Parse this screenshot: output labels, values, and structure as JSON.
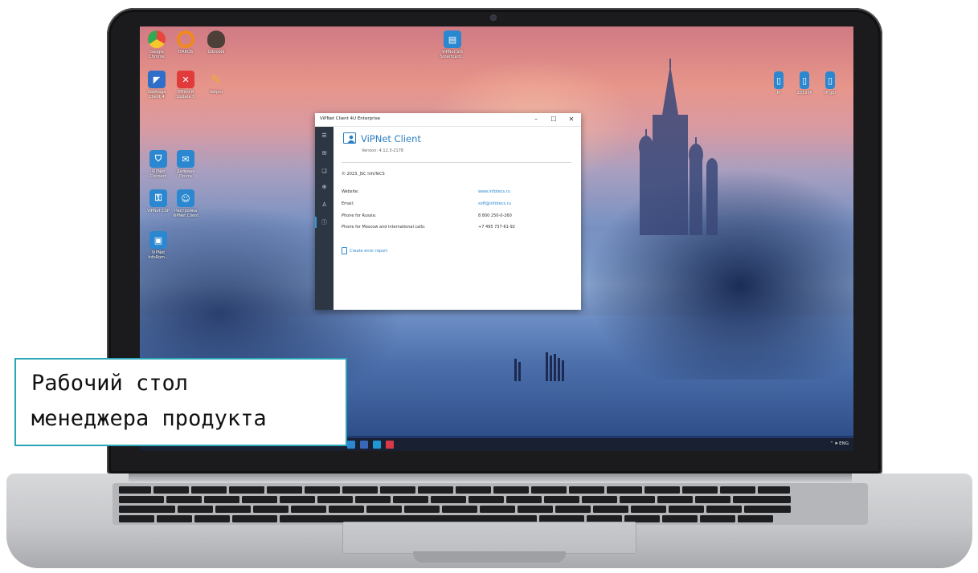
{
  "desktop": {
    "icons": [
      {
        "label": "Google Chrome",
        "icon": "chrome-icon",
        "color": "#e8453c"
      },
      {
        "label": "ITAROS",
        "icon": "itaros-icon",
        "color": "#f08a1c"
      },
      {
        "label": "Gibrovid",
        "icon": "gibrovid-icon",
        "color": "#5a4a3a"
      },
      {
        "label": "Sabfraga Client 4",
        "icon": "sabfraga-icon",
        "color": "#2f6fc9"
      },
      {
        "label": "XMind 8 Update 5",
        "icon": "xmind-icon",
        "color": "#e23b3b"
      },
      {
        "label": "Xetpro",
        "icon": "xetpro-icon",
        "color": "#d59a2a"
      },
      {
        "label": "ViPNet Connect",
        "icon": "vipnet-connect-icon",
        "color": "#2a87d0"
      },
      {
        "label": "Деловая Почта",
        "icon": "business-mail-icon",
        "color": "#2a87d0"
      },
      {
        "label": "ViPNet CSP",
        "icon": "vipnet-csp-icon",
        "color": "#2a87d0"
      },
      {
        "label": "Настройка ViPNet Client",
        "icon": "vipnet-settings-icon",
        "color": "#2a87d0"
      },
      {
        "label": "ViPNet InfoRom...",
        "icon": "vipnet-inforom-icon",
        "color": "#2a87d0"
      },
      {
        "label": "ViPNet SIS Smartcard...",
        "icon": "vipnet-sis-icon",
        "color": "#2a87d0"
      },
      {
        "label": "IP",
        "icon": "file-icon",
        "color": "#2a87d0"
      },
      {
        "label": "2019 IP",
        "icon": "file-icon",
        "color": "#2a87d0"
      },
      {
        "label": "IP gbl",
        "icon": "file-icon",
        "color": "#2a87d0"
      }
    ]
  },
  "window": {
    "title": "ViPNet Client 4U Enterprise",
    "minimize": "–",
    "maximize": "☐",
    "close": "✕",
    "app_name": "ViPNet Client",
    "version": "Version: 4.12.3-2178",
    "copyright": "© 2023, JSC InfoTeCS",
    "rows": [
      {
        "label": "Website:",
        "value": "www.infotecs.ru",
        "link": true
      },
      {
        "label": "Email:",
        "value": "soft@infotecs.ru",
        "link": true
      },
      {
        "label": "Phone for Russia:",
        "value": "8 800 250-0-260",
        "link": false
      },
      {
        "label": "Phone for Moscow and international calls:",
        "value": "+7 495 737-61-92",
        "link": false
      }
    ],
    "error_report": "Create error report",
    "nav_icons": [
      "menu-icon",
      "envelope-icon",
      "chat-icon",
      "globe-icon",
      "user-icon",
      "info-icon"
    ]
  },
  "taskbar": {
    "tray": "⌃ 🕪 ENG"
  },
  "caption": {
    "line1": "Рабочий стол",
    "line2": "менеджера продукта"
  },
  "colors": {
    "accent": "#2b7ec2",
    "caption_border": "#2aa6b8",
    "nav_bg": "#2d3743"
  }
}
